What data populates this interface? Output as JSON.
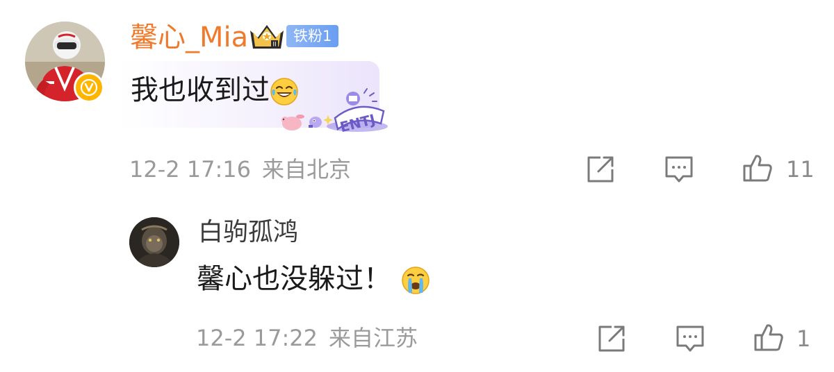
{
  "main_comment": {
    "username": "馨心_Mia",
    "fan_badge": "铁粉1",
    "text": "我也收到过",
    "decoration_text": "ENTJ",
    "timestamp": "12-2 17:16",
    "location": "来自北京",
    "like_count": "11",
    "username_color": "#f07a2c"
  },
  "reply": {
    "username": "白驹孤鸿",
    "text": "馨心也没躲过！",
    "timestamp": "12-2 17:22",
    "location": "来自江苏",
    "like_count": "1"
  },
  "icons": {
    "share": "share-icon",
    "comment": "comment-icon",
    "like": "thumbs-up-icon",
    "verified": "verified-v-icon",
    "crown": "crown-icon",
    "laugh_emoji": "laughing-tears-emoji",
    "cry_emoji": "crying-emoji"
  }
}
